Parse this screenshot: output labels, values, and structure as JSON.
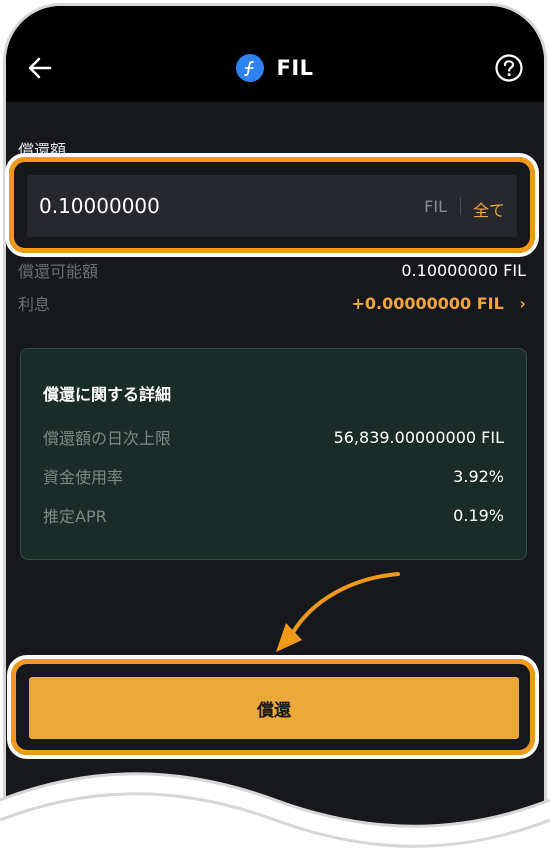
{
  "header": {
    "title": "FIL",
    "coin_icon": "filecoin-icon",
    "back_icon": "arrow-left-icon",
    "help_icon": "question-circle-icon"
  },
  "repay_form": {
    "amount_label": "償還額",
    "amount_value": "0.10000000",
    "unit": "FIL",
    "all_label": "全て"
  },
  "summary": {
    "repayable_label": "償還可能額",
    "repayable_value": "0.10000000 FIL",
    "interest_label": "利息",
    "interest_value": "+0.00000000 FIL",
    "interest_chevron": "›"
  },
  "details": {
    "title": "償還に関する詳細",
    "rows": [
      {
        "label": "償還額の日次上限",
        "value": "56,839.00000000 FIL"
      },
      {
        "label": "資金使用率",
        "value": "3.92%"
      },
      {
        "label": "推定APR",
        "value": "0.19%"
      }
    ]
  },
  "actions": {
    "repay_label": "償還"
  },
  "colors": {
    "accent": "#f0a63a",
    "highlight": "#f19a1a",
    "button": "#eba939",
    "panel": "#1a2c28",
    "background": "#17181b"
  }
}
